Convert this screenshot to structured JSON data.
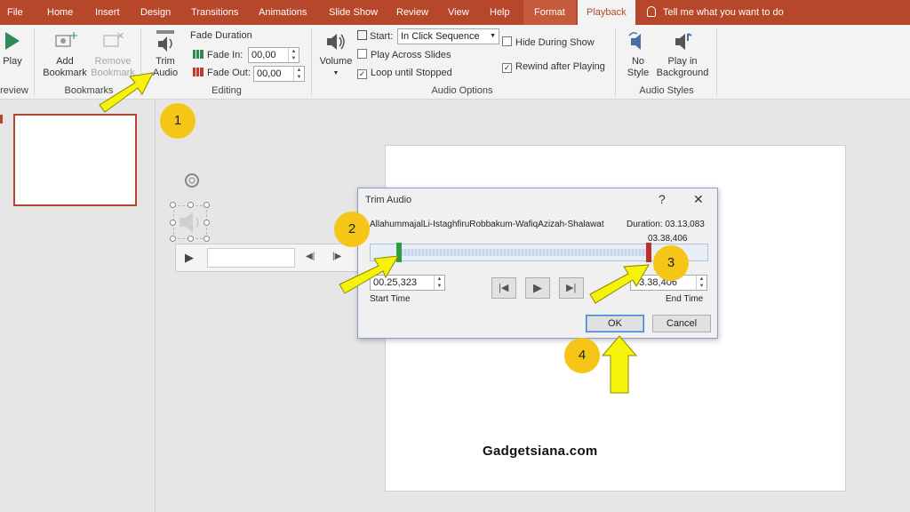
{
  "tabs": [
    "File",
    "Home",
    "Insert",
    "Design",
    "Transitions",
    "Animations",
    "Slide Show",
    "Review",
    "View",
    "Help",
    "Format",
    "Playback"
  ],
  "tell_me": "Tell me what you want to do",
  "ribbon": {
    "preview_label": "Play",
    "preview_group": "review",
    "add_bookmark": "Add Bookmark",
    "remove_bookmark": "Remove Bookmark",
    "bookmarks_group": "Bookmarks",
    "trim_audio": "Trim Audio",
    "fade_duration": "Fade Duration",
    "fade_in_label": "Fade In:",
    "fade_in_value": "00,00",
    "fade_out_label": "Fade Out:",
    "fade_out_value": "00,00",
    "editing_group": "Editing",
    "volume": "Volume",
    "start_label": "Start:",
    "start_value": "In Click Sequence",
    "play_across": "Play Across Slides",
    "loop": "Loop until Stopped",
    "hide_during": "Hide During Show",
    "rewind": "Rewind after Playing",
    "audio_options_group": "Audio Options",
    "no_style": "No Style",
    "play_bg": "Play in Background",
    "audio_styles_group": "Audio Styles"
  },
  "dialog": {
    "title": "Trim Audio",
    "help": "?",
    "close": "✕",
    "filename": "AllahummajalLi-IstaghfiruRobbakum-WafiqAzizah-Shalawat",
    "duration": "Duration: 03.13,083",
    "marker_time": "03.38,406",
    "start_value": "00.25,323",
    "start_label": "Start Time",
    "end_value": "03.38,406",
    "end_label": "End Time",
    "ok": "OK",
    "cancel": "Cancel"
  },
  "annotations": [
    "1",
    "2",
    "3",
    "4"
  ],
  "watermark": "Gadgetsiana.com",
  "colors": {
    "accent": "#b7472a",
    "badge": "#f5c518",
    "arrow": "#f7f20a"
  }
}
